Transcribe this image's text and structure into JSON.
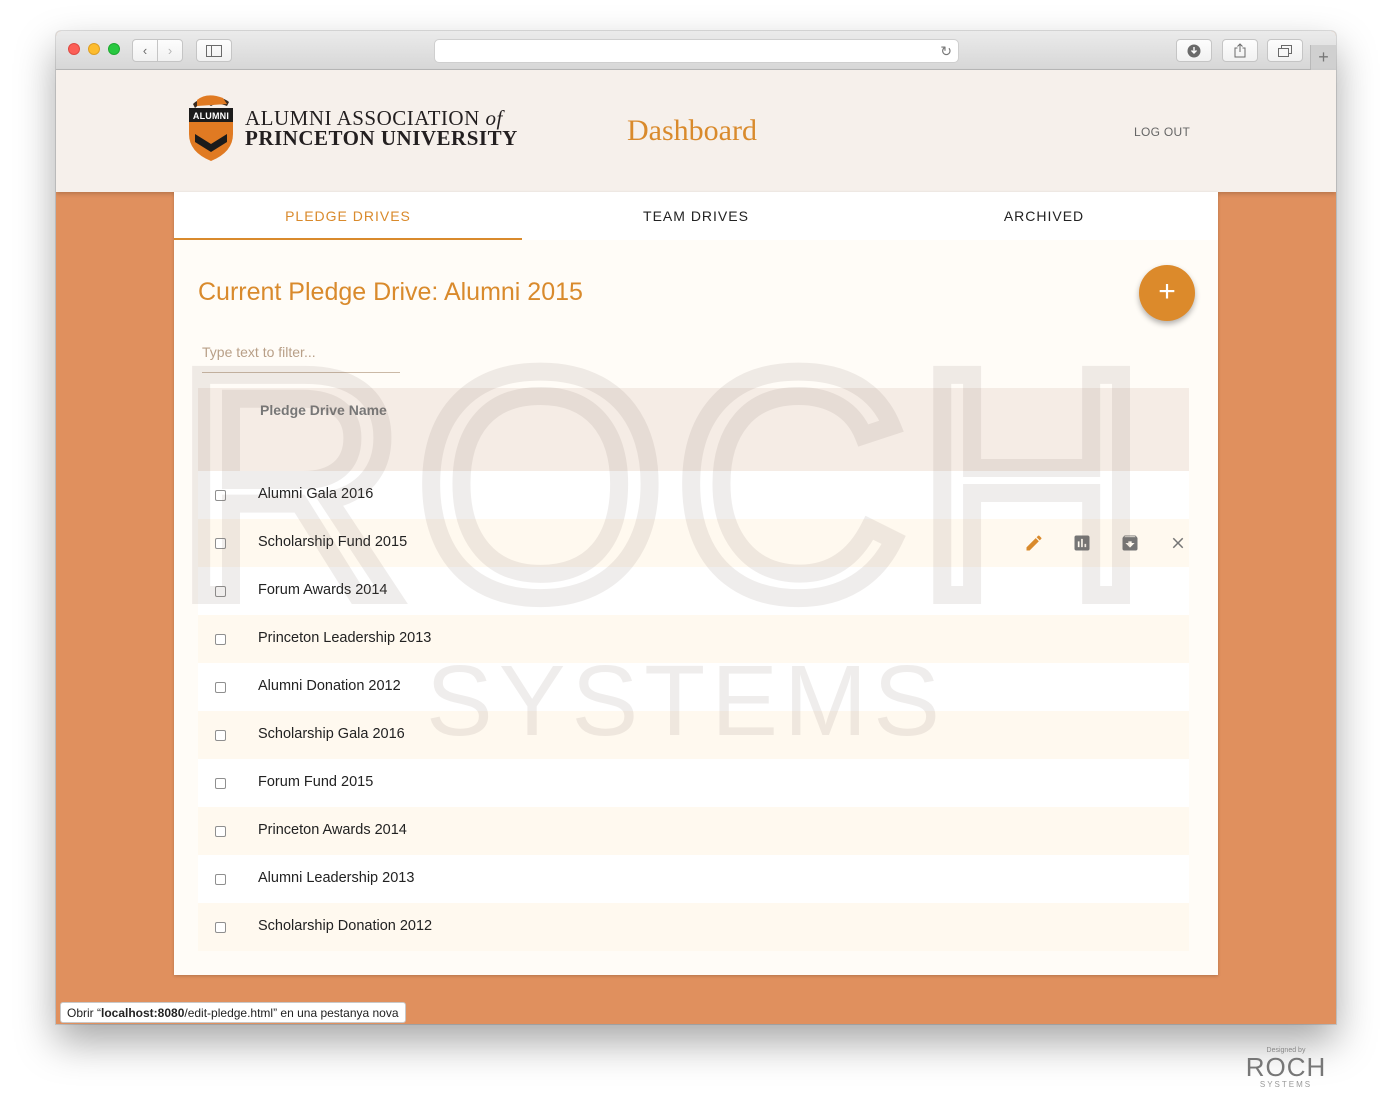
{
  "browser": {
    "status_url_prefix": "Obrir “",
    "status_url_host": "localhost:8080",
    "status_url_path": "/edit-pledge.html",
    "status_url_suffix": "” en una pestanya nova"
  },
  "header": {
    "logo_line1": "ALUMNI ASSOCIATION",
    "logo_line1_of": "of",
    "logo_line2": "PRINCETON UNIVERSITY",
    "shield_label": "ALUMNI",
    "title": "Dashboard",
    "logout_label": "LOG OUT"
  },
  "tabs": [
    {
      "label": "PLEDGE DRIVES",
      "active": true
    },
    {
      "label": "TEAM DRIVES",
      "active": false
    },
    {
      "label": "ARCHIVED",
      "active": false
    }
  ],
  "main": {
    "drive_title": "Current Pledge Drive: Alumni 2015",
    "fab_icon": "plus-icon",
    "filter_placeholder": "Type text to filter...",
    "column_header": "Pledge Drive Name",
    "rows": [
      {
        "name": "Alumni Gala 2016"
      },
      {
        "name": "Scholarship Fund 2015"
      },
      {
        "name": "Forum Awards 2014"
      },
      {
        "name": "Princeton Leadership 2013"
      },
      {
        "name": "Alumni Donation 2012"
      },
      {
        "name": "Scholarship Gala 2016"
      },
      {
        "name": "Forum Fund 2015"
      },
      {
        "name": "Princeton Awards 2014"
      },
      {
        "name": "Alumni Leadership 2013"
      },
      {
        "name": "Scholarship Donation 2012"
      }
    ],
    "row_actions": [
      "edit-icon",
      "bar-chart-icon",
      "archive-icon",
      "close-icon"
    ]
  },
  "watermark": {
    "big": "ROCH",
    "small": "SYSTEMS"
  },
  "credit": {
    "designed_by": "Designed by",
    "brand": "ROCH",
    "sub": "SYSTEMS"
  },
  "colors": {
    "accent": "#d98a2c",
    "page_background": "#e0905e",
    "header_background": "#f6f0eb"
  }
}
